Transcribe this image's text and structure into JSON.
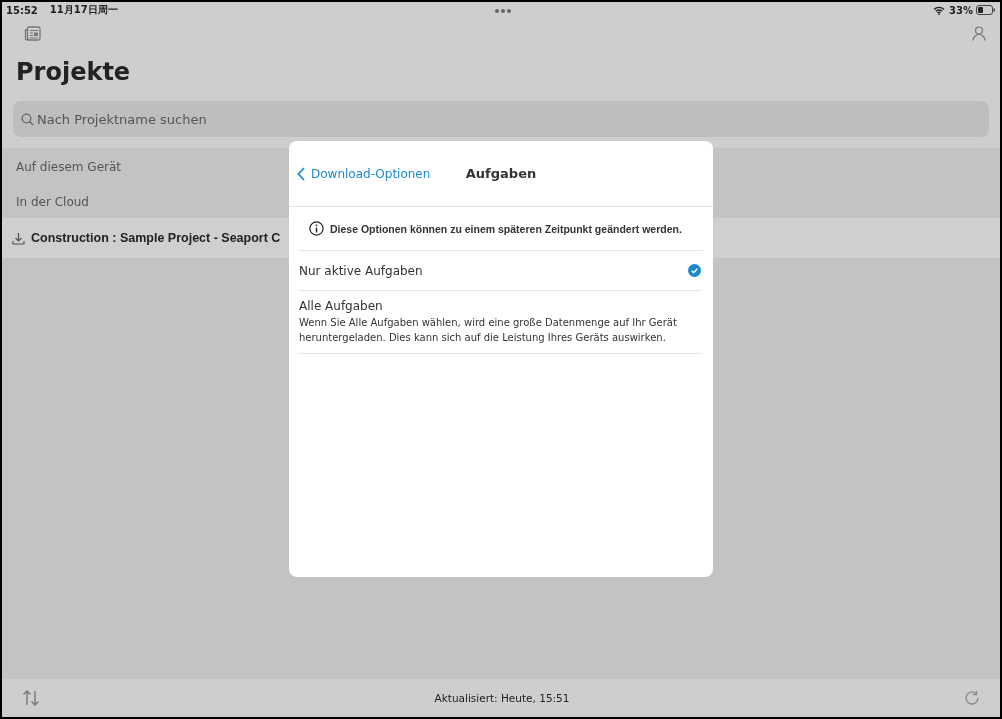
{
  "status_bar": {
    "time": "15:52",
    "date": "11月17日周一",
    "battery": "33%"
  },
  "header": {
    "title": "Projekte"
  },
  "search": {
    "placeholder": "Nach Projektname suchen"
  },
  "sections": [
    {
      "label": "Auf diesem Gerät"
    },
    {
      "label": "In der Cloud",
      "projects": [
        {
          "name": "Construction : Sample Project - Seaport C"
        }
      ]
    }
  ],
  "dialog": {
    "back": "Download-Optionen",
    "title": "Aufgaben",
    "info": "Diese Optionen können zu einem späteren Zeitpunkt geändert werden.",
    "options": [
      {
        "label": "Nur aktive Aufgaben",
        "selected": true
      },
      {
        "label": "Alle Aufgaben",
        "description": "Wenn Sie Alle Aufgaben wählen, wird eine große Datenmenge auf Ihr Gerät heruntergeladen. Dies kann sich auf die Leistung Ihres Geräts auswirken.",
        "selected": false
      }
    ]
  },
  "footer": {
    "updated": "Aktualisiert: Heute, 15:51"
  }
}
